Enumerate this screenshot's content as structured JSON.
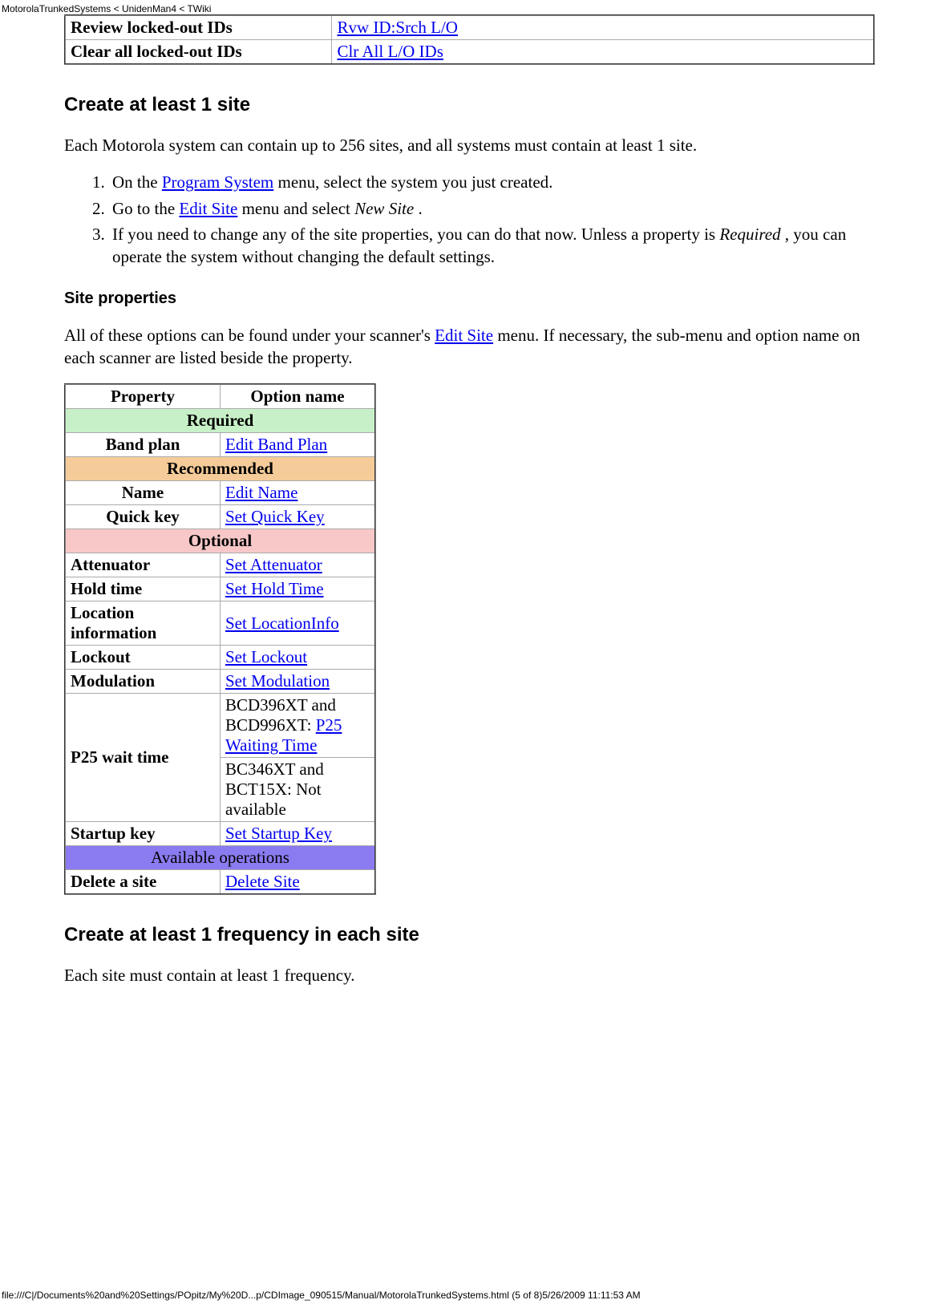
{
  "header": {
    "breadcrumb": "MotorolaTrunkedSystems < UnidenMan4 < TWiki"
  },
  "topTable": {
    "rows": [
      {
        "label": "Review locked-out IDs",
        "link": "Rvw ID:Srch L/O"
      },
      {
        "label": "Clear all locked-out IDs",
        "link": "Clr All L/O IDs"
      }
    ]
  },
  "section1": {
    "heading": "Create at least 1 site",
    "intro": "Each Motorola system can contain up to 256 sites, and all systems must contain at least 1 site.",
    "steps": {
      "s1_a": "On the ",
      "s1_link": "Program System",
      "s1_b": " menu, select the system you just created.",
      "s2_a": "Go to the ",
      "s2_link": "Edit Site",
      "s2_b": " menu and select ",
      "s2_em": "New Site ",
      "s2_c": ".",
      "s3_a": "If you need to change any of the site properties, you can do that now. Unless a property is ",
      "s3_em": "Required ",
      "s3_b": ", you can operate the system without changing the default settings."
    }
  },
  "section2": {
    "heading": "Site properties",
    "intro_a": "All of these options can be found under your scanner's ",
    "intro_link": "Edit Site",
    "intro_b": " menu. If necessary, the sub-menu and option name on each scanner are listed beside the property."
  },
  "propsTable": {
    "header": {
      "c1": "Property",
      "c2": "Option name"
    },
    "groups": {
      "required": "Required",
      "recommended": "Recommended",
      "optional": "Optional",
      "ops": "Available operations"
    },
    "rows": {
      "bandplan": {
        "prop": "Band plan",
        "opt": "Edit Band Plan"
      },
      "name": {
        "prop": "Name",
        "opt": "Edit Name"
      },
      "quickkey": {
        "prop": "Quick key",
        "opt": "Set Quick Key"
      },
      "atten": {
        "prop": "Attenuator",
        "opt": "Set Attenuator"
      },
      "hold": {
        "prop": "Hold time",
        "opt": "Set Hold Time"
      },
      "loc": {
        "prop": "Location information",
        "opt": "Set LocationInfo"
      },
      "lockout": {
        "prop": "Lockout",
        "opt": "Set Lockout"
      },
      "mod": {
        "prop": "Modulation",
        "opt": "Set Modulation"
      },
      "p25": {
        "prop": "P25 wait time",
        "opt1_a": "BCD396XT and BCD996XT: ",
        "opt1_link": "P25 Waiting Time",
        "opt2": "BC346XT and BCT15X: Not available"
      },
      "startup": {
        "prop": "Startup key",
        "opt": "Set Startup Key"
      },
      "delete": {
        "prop": "Delete a site",
        "opt": "Delete Site"
      }
    }
  },
  "section3": {
    "heading": "Create at least 1 frequency in each site",
    "intro": "Each site must contain at least 1 frequency."
  },
  "footer": {
    "text": "file:///C|/Documents%20and%20Settings/POpitz/My%20D...p/CDImage_090515/Manual/MotorolaTrunkedSystems.html (5 of 8)5/26/2009 11:11:53 AM"
  }
}
